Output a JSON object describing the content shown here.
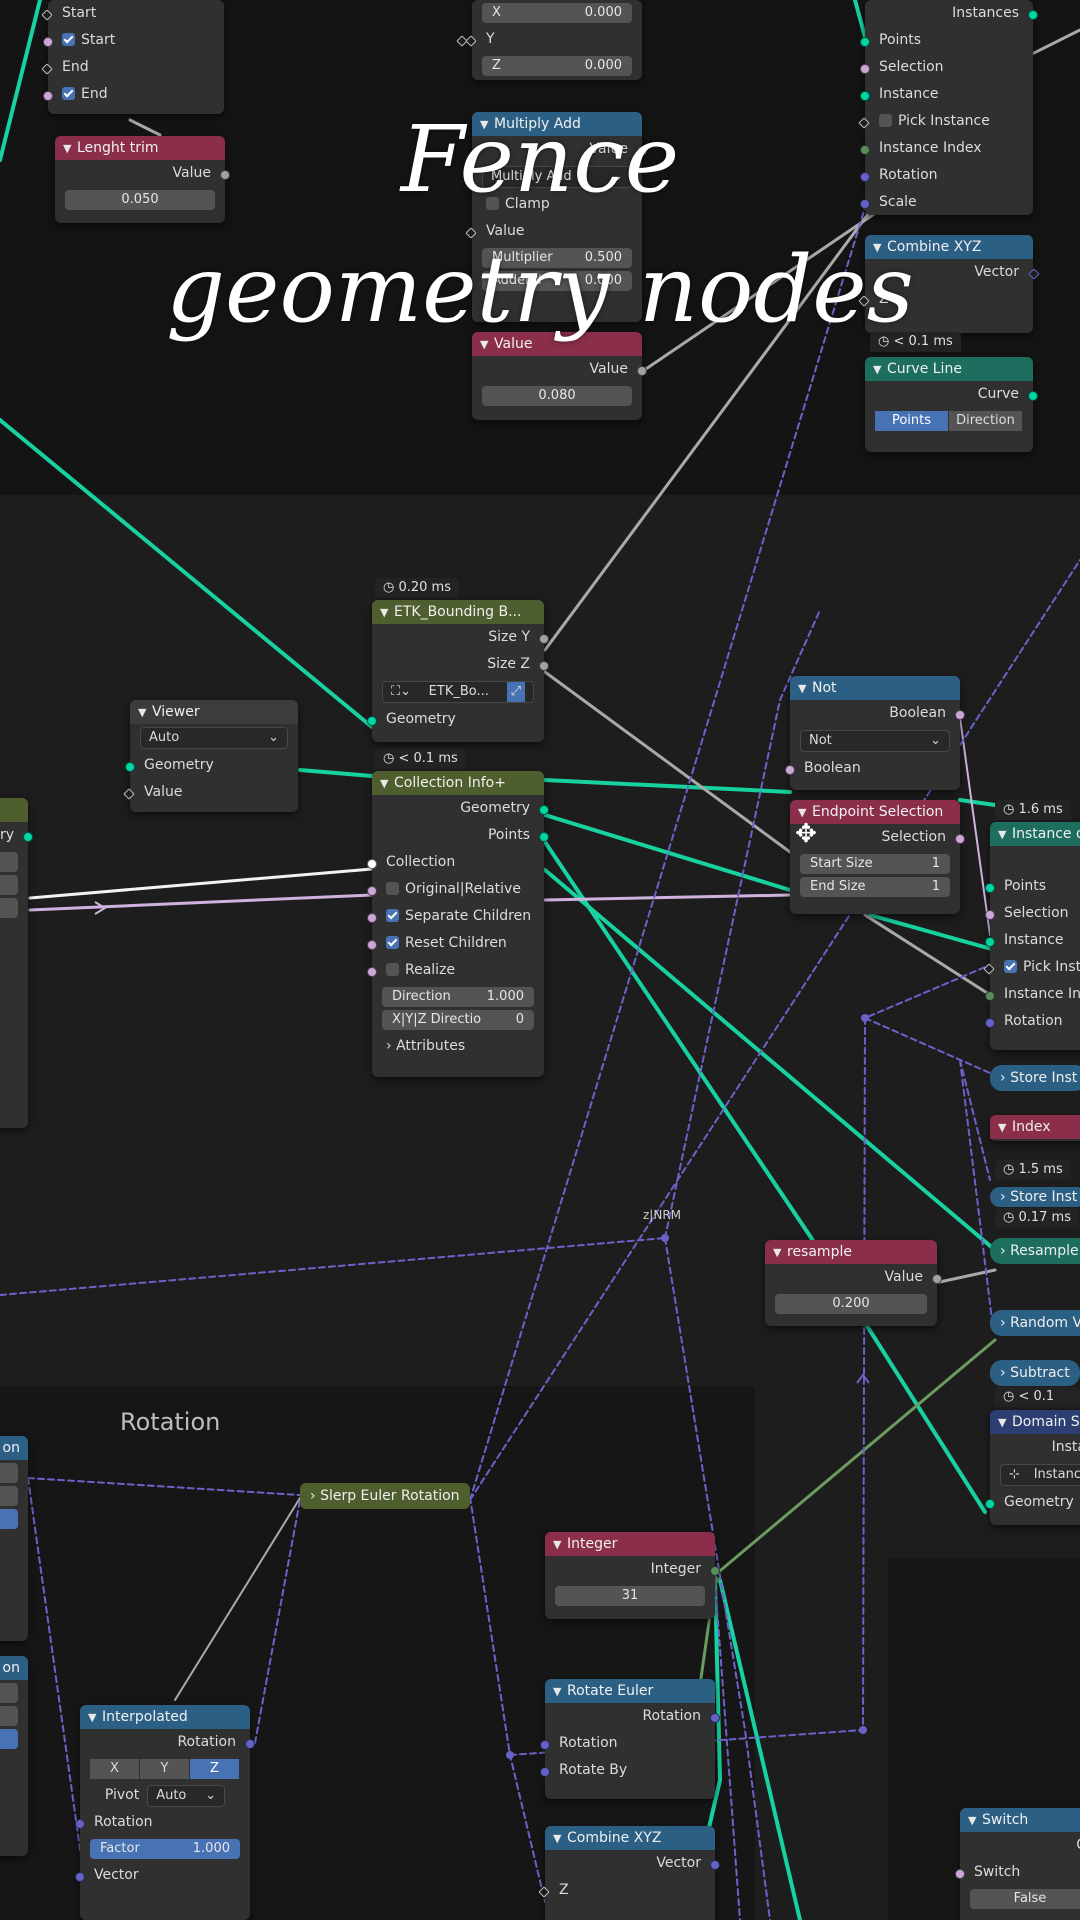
{
  "overlay": {
    "line1": "Fence",
    "line2": "geometry nodes"
  },
  "frames": {
    "rotation": "Rotation"
  },
  "reroute": {
    "zlabel": "z|NRM"
  },
  "nodes": {
    "topleft": {
      "r1": "Start",
      "r2": "Start",
      "r3": "End",
      "r4": "End"
    },
    "length_trim": {
      "title": "Lenght trim",
      "out": "Value",
      "value": "0.050"
    },
    "vec_top": {
      "x_label": "X",
      "x_value": "0.000",
      "y_label": "Y",
      "z_label": "Z",
      "z_value": "0.000"
    },
    "multiply_add": {
      "title": "Multiply Add",
      "out": "Value",
      "op": "Multiply Add",
      "clamp": "Clamp",
      "in": "Value",
      "mul_label": "Multiplier",
      "mul_value": "0.500",
      "add_label": "Addend",
      "add_value": "0.000"
    },
    "value_080": {
      "title": "Value",
      "out": "Value",
      "value": "0.080"
    },
    "instance_top": {
      "o1": "Instances",
      "r1": "Points",
      "r2": "Selection",
      "r3": "Instance",
      "r4": "Pick Instance",
      "r5": "Instance Index",
      "r6": "Rotation",
      "r7": "Scale"
    },
    "combine_xyz_top": {
      "title": "Combine XYZ",
      "out": "Vector",
      "timer": "< 0.1 ms",
      "z": "Z"
    },
    "curve_line": {
      "title": "Curve Line",
      "out": "Curve",
      "mode_a": "Points",
      "mode_b": "Direction"
    },
    "etk": {
      "timer": "0.20 ms",
      "title": "ETK_Bounding B...",
      "o1": "Size Y",
      "o2": "Size Z",
      "ref": "ETK_Bo...",
      "in": "Geometry"
    },
    "viewer": {
      "title": "Viewer",
      "mode": "Auto",
      "r1": "Geometry",
      "r2": "Value"
    },
    "collection_info": {
      "timer": "< 0.1 ms",
      "title": "Collection Info+",
      "o1": "Geometry",
      "o2": "Points",
      "r1": "Collection",
      "r2": "Original|Relative",
      "r3": "Separate Children",
      "r4": "Reset Children",
      "r5": "Realize",
      "dir_label": "Direction",
      "dir_value": "1.000",
      "xyz_label": "X|Y|Z Directio",
      "xyz_value": "0",
      "r8": "Attributes"
    },
    "not": {
      "title": "Not",
      "out": "Boolean",
      "op": "Not",
      "in": "Boolean"
    },
    "endpoint": {
      "title": "Endpoint Selection",
      "out": "Selection",
      "start_label": "Start Size",
      "start_value": "1",
      "end_label": "End Size",
      "end_value": "1"
    },
    "left_partial": {
      "r1": "ry"
    },
    "instance_right": {
      "timer": "1.6 ms",
      "title": "Instance o",
      "r1": "Points",
      "r2": "Selection",
      "r3": "Instance",
      "r4": "Pick Instan",
      "r5": "Instance Ind",
      "r6": "Rotation"
    },
    "store_inst_1": {
      "title": "Store Inst"
    },
    "index": {
      "title": "Index",
      "timer": "1.5 ms"
    },
    "store_inst_2": {
      "title": "Store Inst",
      "timer": "0.17 ms"
    },
    "resample_right": {
      "title": "Resample"
    },
    "resample": {
      "title": "resample",
      "out": "Value",
      "value": "0.200"
    },
    "random_v": {
      "title": "Random V"
    },
    "subtract": {
      "title": "Subtract",
      "timer": "< 0.1 ms"
    },
    "domain_size": {
      "title": "Domain Si",
      "r1": "Insta",
      "mode": "Instanc",
      "r2": "Geometry"
    },
    "slerp": {
      "title": "Slerp Euler Rotation"
    },
    "integer": {
      "title": "Integer",
      "out": "Integer",
      "value": "31"
    },
    "rotate_euler": {
      "title": "Rotate Euler",
      "out": "Rotation",
      "r1": "Rotation",
      "r2": "Rotate By"
    },
    "combine_xyz_bottom": {
      "title": "Combine XYZ",
      "out": "Vector",
      "r1": "Z"
    },
    "interpolated": {
      "title": "Interpolated",
      "out": "Rotation",
      "x": "X",
      "y": "Y",
      "z": "Z",
      "pivot_label": "Pivot",
      "pivot_value": "Auto",
      "r1": "Rotation",
      "factor_label": "Factor",
      "factor_value": "1.000",
      "r2": "Vector"
    },
    "left_edge": {
      "a": "on",
      "b": "on"
    },
    "switch": {
      "title": "Switch",
      "r0": "C",
      "r1": "Switch",
      "value": "False"
    }
  }
}
